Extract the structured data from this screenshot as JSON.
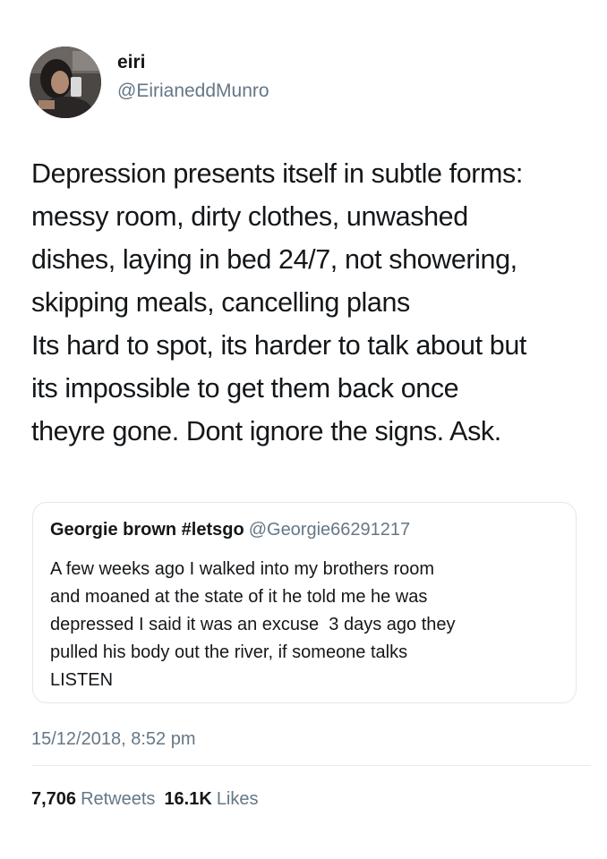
{
  "author": {
    "display_name": "eiri",
    "handle": "@EirianeddMunro",
    "avatar_icon": "profile-photo"
  },
  "tweet": {
    "lines": [
      "Depression presents itself in subtle forms:",
      "messy room, dirty clothes, unwashed",
      "dishes, laying in bed 24/7, not showering,",
      "skipping meals, cancelling plans",
      "Its hard to spot, its harder to talk about but",
      "its impossible to get them back once",
      "theyre gone. Dont ignore the signs. Ask."
    ]
  },
  "quoted_tweet": {
    "name": "Georgie brown #letsgo",
    "handle": "@Georgie66291217",
    "lines": [
      "A few weeks ago I walked into my brothers room",
      "and moaned at the state of it he told me he was",
      "depressed I said it was an excuse  3 days ago they",
      "pulled his body out the river, if someone talks",
      "LISTEN"
    ]
  },
  "timestamp": "15/12/2018, 8:52 pm",
  "stats": {
    "retweets_count": "7,706",
    "retweets_label": "Retweets",
    "likes_count": "16.1K",
    "likes_label": "Likes"
  },
  "colors": {
    "text": "#14171a",
    "secondary_text": "#657786",
    "border": "#e1e8ed"
  }
}
